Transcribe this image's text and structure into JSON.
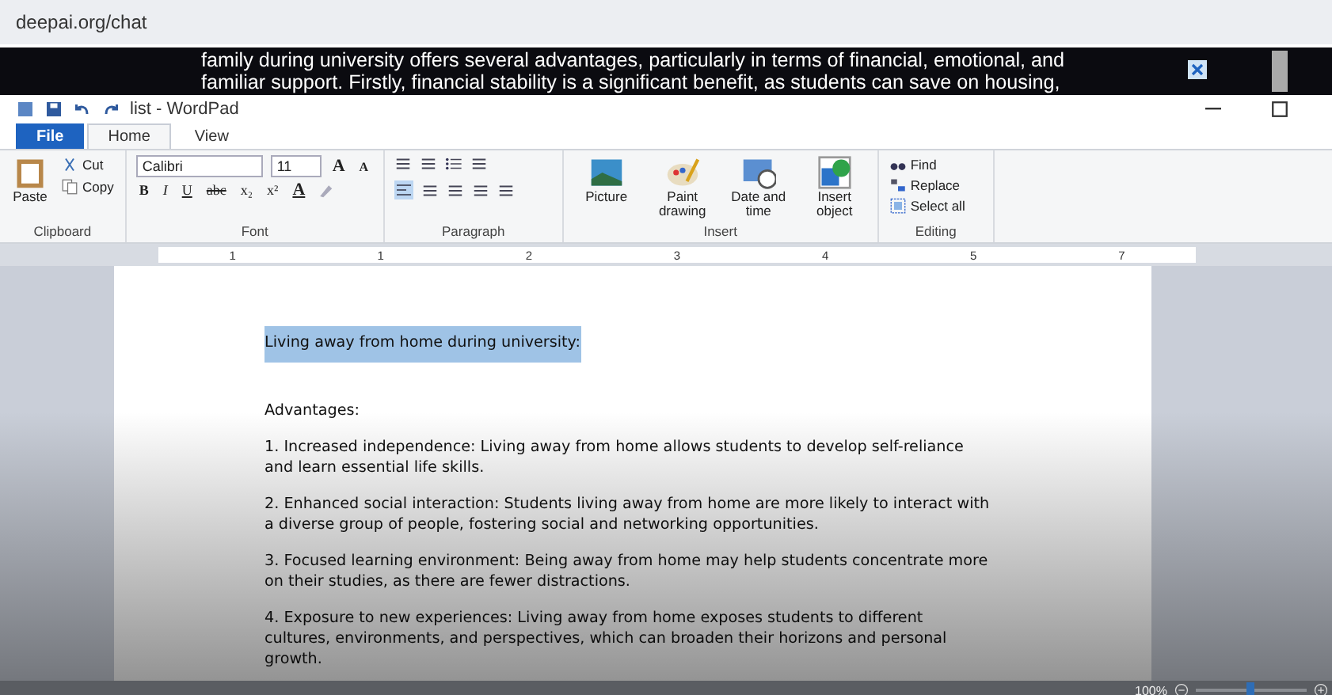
{
  "browser": {
    "address": "deepai.org/chat"
  },
  "caption": {
    "lines": [
      "family during university offers several advantages, particularly in terms of financial, emotional, and",
      "familiar support. Firstly, financial stability is a significant benefit, as students can save on housing,"
    ]
  },
  "window": {
    "title": "list - WordPad"
  },
  "tabs": [
    {
      "label": "File",
      "kind": "file",
      "selected": false
    },
    {
      "label": "Home",
      "kind": "tab",
      "selected": true
    },
    {
      "label": "View",
      "kind": "tab",
      "selected": false
    }
  ],
  "ribbon": {
    "clipboard": {
      "label": "Clipboard",
      "paste": "Paste",
      "cut": "Cut",
      "copy": "Copy"
    },
    "font": {
      "label": "Font",
      "family": "Calibri",
      "size": "11",
      "grow": "A",
      "shrink": "A",
      "bold": "B",
      "italic": "I",
      "underline": "U",
      "strike": "abc",
      "subscript": "x₂",
      "superscript": "x²",
      "font_color_button": "A"
    },
    "paragraph": {
      "label": "Paragraph"
    },
    "insert": {
      "label": "Insert",
      "buttons": [
        {
          "label": "Picture",
          "kind": "picture"
        },
        {
          "label": "Paint drawing",
          "kind": "paint"
        },
        {
          "label": "Date and time",
          "kind": "date"
        },
        {
          "label": "Insert object",
          "kind": "object"
        }
      ]
    },
    "editing": {
      "label": "Editing",
      "buttons": [
        {
          "label": "Find",
          "kind": "find"
        },
        {
          "label": "Replace",
          "kind": "replace"
        },
        {
          "label": "Select all",
          "kind": "selectall"
        }
      ]
    }
  },
  "ruler": [
    "1",
    "1",
    "2",
    "3",
    "4",
    "5",
    "7"
  ],
  "document": {
    "paragraphs": [
      {
        "text": "Living away from home during university:",
        "selected": true
      },
      {
        "text": "Advantages:",
        "selected": false
      },
      {
        "text": "1. Increased independence: Living away from home allows students to develop self-reliance and learn essential life skills.",
        "selected": false
      },
      {
        "text": "2. Enhanced social interaction: Students living away from home are more likely to interact with a diverse group of people, fostering social and networking opportunities.",
        "selected": false
      },
      {
        "text": "3. Focused learning environment: Being away from home may help students concentrate more on their studies, as there are fewer distractions.",
        "selected": false
      },
      {
        "text": "4. Exposure to new experiences: Living away from home exposes students to different cultures, environments, and perspectives, which can broaden their horizons and personal growth.",
        "selected": false
      }
    ]
  },
  "status_bar": {
    "zoom": "100%",
    "zoom_slider": {
      "level": 0.45
    }
  }
}
